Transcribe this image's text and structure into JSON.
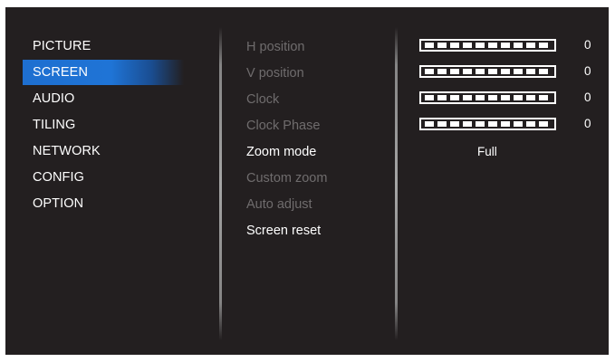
{
  "main_menu": {
    "items": [
      {
        "label": "PICTURE",
        "selected": false
      },
      {
        "label": "SCREEN",
        "selected": true
      },
      {
        "label": "AUDIO",
        "selected": false
      },
      {
        "label": "TILING",
        "selected": false
      },
      {
        "label": "NETWORK",
        "selected": false
      },
      {
        "label": "CONFIG",
        "selected": false
      },
      {
        "label": "OPTION",
        "selected": false
      }
    ]
  },
  "screen_menu": {
    "items": [
      {
        "label": "H position",
        "enabled": false
      },
      {
        "label": "V position",
        "enabled": false
      },
      {
        "label": "Clock",
        "enabled": false
      },
      {
        "label": "Clock Phase",
        "enabled": false
      },
      {
        "label": "Zoom mode",
        "enabled": true
      },
      {
        "label": "Custom zoom",
        "enabled": false
      },
      {
        "label": "Auto adjust",
        "enabled": false
      },
      {
        "label": "Screen reset",
        "enabled": true
      }
    ]
  },
  "values": {
    "h_position": "0",
    "v_position": "0",
    "clock": "0",
    "clock_phase": "0",
    "zoom_mode": "Full"
  },
  "colors": {
    "background": "#231f20",
    "selection": "#1f74d6",
    "disabled_text": "#6f6c6d"
  }
}
